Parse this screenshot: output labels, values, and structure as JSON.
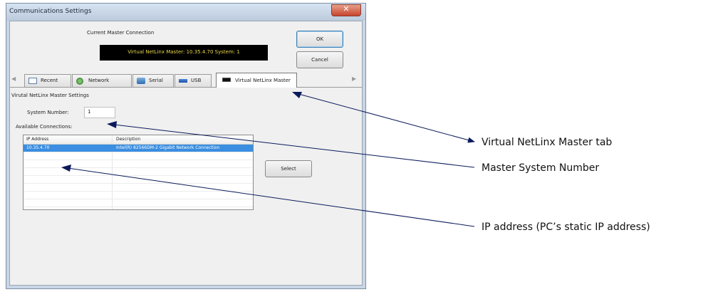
{
  "window": {
    "title": "Communications Settings",
    "close_glyph": "✕"
  },
  "connection": {
    "label": "Current Master Connection",
    "display": "Virtual NetLinx Master: 10.35.4.70  System: 1"
  },
  "buttons": {
    "ok": "OK",
    "cancel": "Cancel",
    "select": "Select"
  },
  "tabs": [
    {
      "label": "Recent",
      "icon": "recent-icon"
    },
    {
      "label": "Network",
      "icon": "network-icon"
    },
    {
      "label": "Serial",
      "icon": "serial-icon"
    },
    {
      "label": "USB",
      "icon": "usb-icon"
    },
    {
      "label": "Virtual NetLinx Master",
      "icon": "virtual-master-icon",
      "selected": true
    }
  ],
  "settings": {
    "section_label": "Virutal NetLinx Master Settings",
    "system_number_label": "System Number:",
    "system_number_value": "1",
    "available_label": "Available Connections:"
  },
  "connections_table": {
    "columns": [
      "IP Address",
      "Description"
    ],
    "rows": [
      {
        "ip": "10.35.4.70",
        "description": "Intel(R) 82566DM-2 Gigabit Network Connection",
        "selected": true
      }
    ]
  },
  "annotations": [
    "Virtual NetLinx Master tab",
    "Master System Number",
    "IP address (PC’s static IP address)"
  ],
  "colors": {
    "selection": "#3b8ee0",
    "display_bg": "#000000",
    "display_text": "#e8d84a",
    "arrow": "#0b1a5a"
  }
}
